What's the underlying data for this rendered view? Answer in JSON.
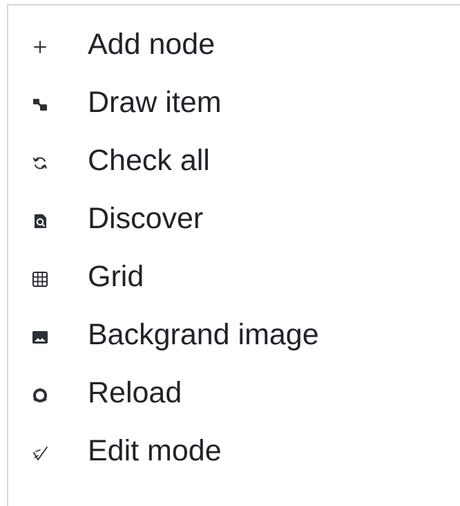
{
  "menu": {
    "items": [
      {
        "label": "Add node",
        "icon": "plus-icon"
      },
      {
        "label": "Draw item",
        "icon": "draw-item-icon"
      },
      {
        "label": "Check all",
        "icon": "refresh-check-icon"
      },
      {
        "label": "Discover",
        "icon": "discover-icon"
      },
      {
        "label": "Grid",
        "icon": "grid-icon"
      },
      {
        "label": "Backgrand image",
        "icon": "image-icon"
      },
      {
        "label": "Reload",
        "icon": "reload-icon"
      },
      {
        "label": "Edit mode",
        "icon": "edit-mode-icon"
      }
    ]
  },
  "colors": {
    "text": "#1f2329",
    "icon": "#2b2f36",
    "border": "#d6d6da",
    "background": "#ffffff"
  }
}
